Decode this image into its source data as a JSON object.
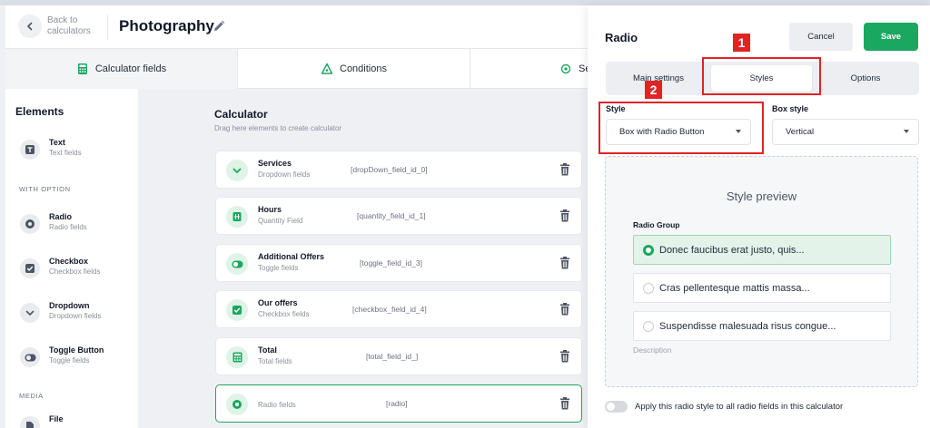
{
  "header": {
    "back_label": "Back to calculators",
    "title": "Photography"
  },
  "tabs": [
    {
      "label": "Calculator fields",
      "icon": "calculator-icon",
      "active": true
    },
    {
      "label": "Conditions",
      "icon": "conditions-icon",
      "active": false
    },
    {
      "label": "Se",
      "icon": "settings-icon",
      "active": false
    }
  ],
  "sidebar": {
    "title": "Elements",
    "section_with_option": "WITH OPTION",
    "section_media": "MEDIA",
    "items": [
      {
        "name": "Text",
        "sub": "Text fields",
        "icon": "text-icon"
      },
      {
        "name": "Radio",
        "sub": "Radio fields",
        "icon": "radio-icon"
      },
      {
        "name": "Checkbox",
        "sub": "Checkbox fields",
        "icon": "checkbox-icon"
      },
      {
        "name": "Dropdown",
        "sub": "Dropdown fields",
        "icon": "dropdown-icon"
      },
      {
        "name": "Toggle Button",
        "sub": "Toggle fields",
        "icon": "toggle-icon"
      },
      {
        "name": "File",
        "sub": "",
        "icon": "file-icon"
      }
    ]
  },
  "calculator": {
    "title": "Calculator",
    "subtitle": "Drag here elements to create calculator",
    "fields": [
      {
        "name": "Services",
        "sub": "Dropdown fields",
        "id": "[dropDown_field_id_0]",
        "icon": "chevron-down-icon"
      },
      {
        "name": "Hours",
        "sub": "Quantity Field",
        "id": "[quantity_field_id_1]",
        "icon": "quantity-icon"
      },
      {
        "name": "Additional Offers",
        "sub": "Toggle fields",
        "id": "[toggle_field_id_3]",
        "icon": "toggle-icon"
      },
      {
        "name": "Our offers",
        "sub": "Checkbox fields",
        "id": "[checkbox_field_id_4]",
        "icon": "checkbox-icon"
      },
      {
        "name": "Total",
        "sub": "Total fields",
        "id": "[total_field_id_]",
        "icon": "calculator-icon"
      },
      {
        "name": "",
        "sub": "Radio fields",
        "id": "[radio]",
        "icon": "radio-icon"
      }
    ]
  },
  "panel": {
    "title": "Radio",
    "cancel_label": "Cancel",
    "save_label": "Save",
    "segments": [
      "Main settings",
      "Styles",
      "Options"
    ],
    "active_segment": "Styles",
    "style_label": "Style",
    "style_value": "Box with Radio Button",
    "box_style_label": "Box style",
    "box_style_value": "Vertical",
    "preview": {
      "title": "Style preview",
      "group_label": "Radio Group",
      "options": [
        {
          "label": "Donec faucibus erat justo, quis...",
          "checked": true
        },
        {
          "label": "Cras pellentesque mattis massa...",
          "checked": false
        },
        {
          "label": "Suspendisse malesuada risus congue...",
          "checked": false
        }
      ],
      "description": "Description"
    },
    "toggle_text": "Apply this radio style to all radio fields in this calculator"
  },
  "annotations": [
    {
      "number": "1"
    },
    {
      "number": "2"
    }
  ],
  "colors": {
    "accent": "#1aa760",
    "annotation": "#e02424"
  }
}
